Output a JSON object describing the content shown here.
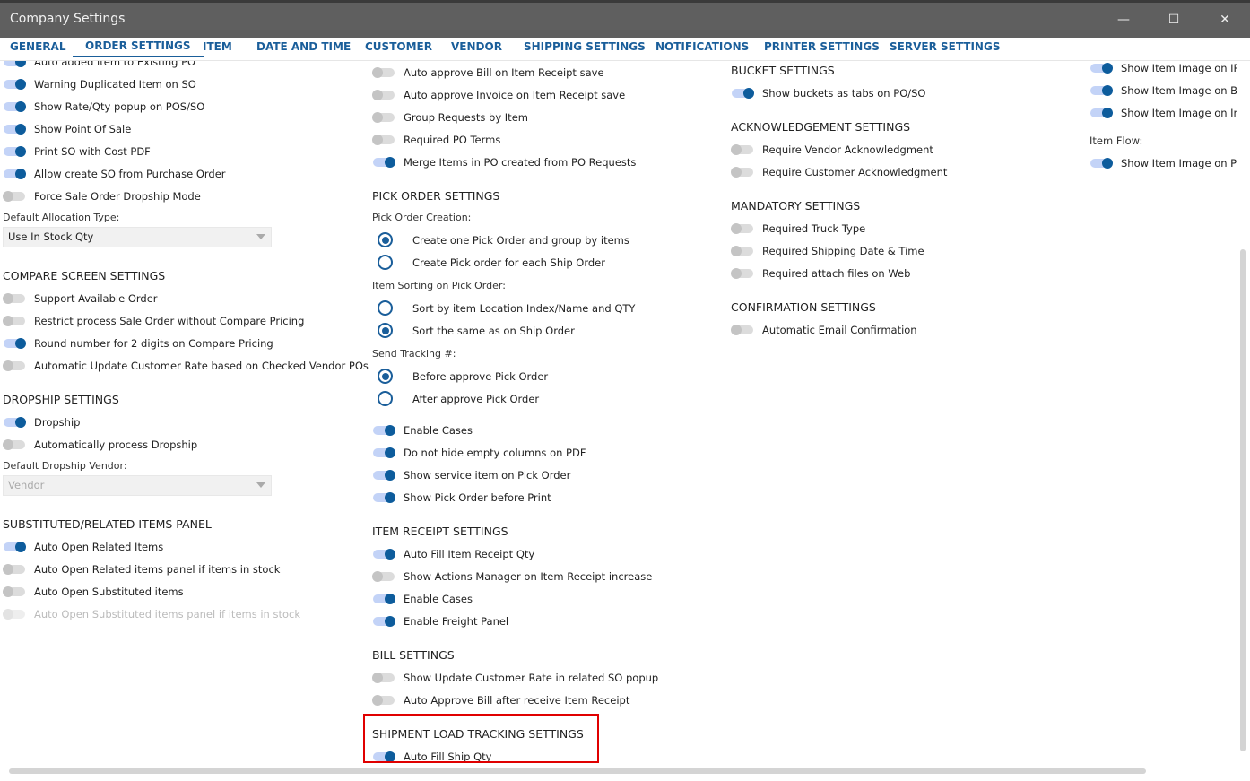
{
  "window": {
    "title": "Company Settings",
    "minimize": "—",
    "maximize": "☐",
    "close": "✕"
  },
  "tabs": [
    {
      "label": "GENERAL"
    },
    {
      "label": "ORDER SETTINGS",
      "active": true
    },
    {
      "label": "ITEM"
    },
    {
      "label": "DATE AND TIME"
    },
    {
      "label": "CUSTOMER"
    },
    {
      "label": "VENDOR"
    },
    {
      "label": "SHIPPING SETTINGS"
    },
    {
      "label": "NOTIFICATIONS"
    },
    {
      "label": "PRINTER SETTINGS"
    },
    {
      "label": "SERVER SETTINGS"
    }
  ],
  "columns": [
    {
      "rows": [
        {
          "type": "toggle",
          "label": "Auto added item to Existing PO",
          "on": true
        },
        {
          "type": "toggle",
          "label": "Warning Duplicated Item on SO",
          "on": true
        },
        {
          "type": "toggle",
          "label": "Show Rate/Qty popup on POS/SO",
          "on": true
        },
        {
          "type": "toggle",
          "label": "Show Point Of Sale",
          "on": true
        },
        {
          "type": "toggle",
          "label": "Print SO with Cost PDF",
          "on": true
        },
        {
          "type": "toggle",
          "label": "Allow create SO from Purchase Order",
          "on": true
        },
        {
          "type": "toggle",
          "label": "Force Sale Order Dropship Mode",
          "on": false
        },
        {
          "type": "label",
          "label": "Default Allocation Type:"
        },
        {
          "type": "select",
          "value": "Use In Stock Qty"
        },
        {
          "type": "header",
          "label": "COMPARE SCREEN SETTINGS"
        },
        {
          "type": "toggle",
          "label": "Support Available Order",
          "on": false
        },
        {
          "type": "toggle",
          "label": "Restrict process Sale Order without Compare Pricing",
          "on": false
        },
        {
          "type": "toggle",
          "label": "Round number for 2 digits on Compare Pricing",
          "on": true
        },
        {
          "type": "toggle",
          "label": "Automatic Update Customer Rate based on Checked Vendor POs",
          "on": false
        },
        {
          "type": "header",
          "label": "DROPSHIP SETTINGS"
        },
        {
          "type": "toggle",
          "label": "Dropship",
          "on": true
        },
        {
          "type": "toggle",
          "label": "Automatically process Dropship",
          "on": false
        },
        {
          "type": "label",
          "label": "Default Dropship Vendor:"
        },
        {
          "type": "select",
          "placeholder": "Vendor"
        },
        {
          "type": "header",
          "label": "SUBSTITUTED/RELATED ITEMS PANEL"
        },
        {
          "type": "toggle",
          "label": "Auto Open Related Items",
          "on": true
        },
        {
          "type": "toggle",
          "label": "Auto Open Related items panel if items in stock",
          "on": false
        },
        {
          "type": "toggle",
          "label": "Auto Open Substituted items",
          "on": false
        },
        {
          "type": "toggle",
          "label": "Auto Open Substituted items panel if items in stock",
          "on": false,
          "disabled": true
        }
      ]
    },
    {
      "rows": [
        {
          "type": "toggle",
          "label": "Auto approve Bill on Item Receipt save",
          "on": false
        },
        {
          "type": "toggle",
          "label": "Auto approve Invoice on Item Receipt save",
          "on": false
        },
        {
          "type": "toggle",
          "label": "Group Requests by Item",
          "on": false
        },
        {
          "type": "toggle",
          "label": "Required PO Terms",
          "on": false
        },
        {
          "type": "toggle",
          "label": "Merge Items in PO created from PO Requests",
          "on": true
        },
        {
          "type": "header",
          "label": "PICK ORDER SETTINGS"
        },
        {
          "type": "label",
          "label": "Pick Order Creation:"
        },
        {
          "type": "radio",
          "label": "Create one Pick Order and group by items",
          "on": true
        },
        {
          "type": "radio",
          "label": "Create Pick order for each Ship Order",
          "on": false
        },
        {
          "type": "label",
          "label": "Item Sorting on Pick Order:"
        },
        {
          "type": "radio",
          "label": "Sort by item Location Index/Name and QTY",
          "on": false
        },
        {
          "type": "radio",
          "label": "Sort the same as on Ship Order",
          "on": true
        },
        {
          "type": "label",
          "label": "Send Tracking #:"
        },
        {
          "type": "radio",
          "label": "Before approve Pick Order",
          "on": true
        },
        {
          "type": "radio",
          "label": "After approve Pick Order",
          "on": false
        },
        {
          "type": "toggle",
          "label": "Enable Cases",
          "on": true
        },
        {
          "type": "toggle",
          "label": "Do not hide empty columns on PDF",
          "on": true
        },
        {
          "type": "toggle",
          "label": "Show service item on Pick Order",
          "on": true
        },
        {
          "type": "toggle",
          "label": "Show Pick Order before Print",
          "on": true
        },
        {
          "type": "header",
          "label": "ITEM RECEIPT SETTINGS"
        },
        {
          "type": "toggle",
          "label": "Auto Fill Item Receipt Qty",
          "on": true
        },
        {
          "type": "toggle",
          "label": "Show Actions Manager on Item Receipt increase",
          "on": false
        },
        {
          "type": "toggle",
          "label": "Enable Cases",
          "on": true
        },
        {
          "type": "toggle",
          "label": "Enable Freight Panel",
          "on": true
        },
        {
          "type": "header",
          "label": "BILL SETTINGS"
        },
        {
          "type": "toggle",
          "label": "Show Update Customer Rate in related SO popup",
          "on": false
        },
        {
          "type": "toggle",
          "label": "Auto Approve Bill after receive Item Receipt",
          "on": false
        },
        {
          "type": "header",
          "label": "SHIPMENT LOAD TRACKING SETTINGS"
        },
        {
          "type": "toggle",
          "label": "Auto Fill Ship Qty",
          "on": true
        }
      ]
    },
    {
      "rows": [
        {
          "type": "header",
          "label": "BUCKET SETTINGS",
          "first": true
        },
        {
          "type": "toggle",
          "label": "Show buckets as tabs on PO/SO",
          "on": true
        },
        {
          "type": "header",
          "label": "ACKNOWLEDGEMENT SETTINGS"
        },
        {
          "type": "toggle",
          "label": "Require Vendor Acknowledgment",
          "on": false
        },
        {
          "type": "toggle",
          "label": "Require Customer Acknowledgment",
          "on": false
        },
        {
          "type": "header",
          "label": "MANDATORY SETTINGS"
        },
        {
          "type": "toggle",
          "label": "Required Truck Type",
          "on": false
        },
        {
          "type": "toggle",
          "label": "Required Shipping Date & Time",
          "on": false
        },
        {
          "type": "toggle",
          "label": "Required attach files on Web",
          "on": false
        },
        {
          "type": "header",
          "label": "CONFIRMATION SETTINGS"
        },
        {
          "type": "toggle",
          "label": "Automatic Email Confirmation",
          "on": false
        }
      ]
    },
    {
      "rows": [
        {
          "type": "toggle",
          "label": "Show Item Image on IR PDF",
          "on": true
        },
        {
          "type": "toggle",
          "label": "Show Item Image on Bill",
          "on": true
        },
        {
          "type": "toggle",
          "label": "Show Item Image on Invoice",
          "on": true
        },
        {
          "type": "label",
          "label": "Item Flow:",
          "big": true
        },
        {
          "type": "toggle",
          "label": "Show Item Image on PDF",
          "on": true
        }
      ]
    }
  ]
}
